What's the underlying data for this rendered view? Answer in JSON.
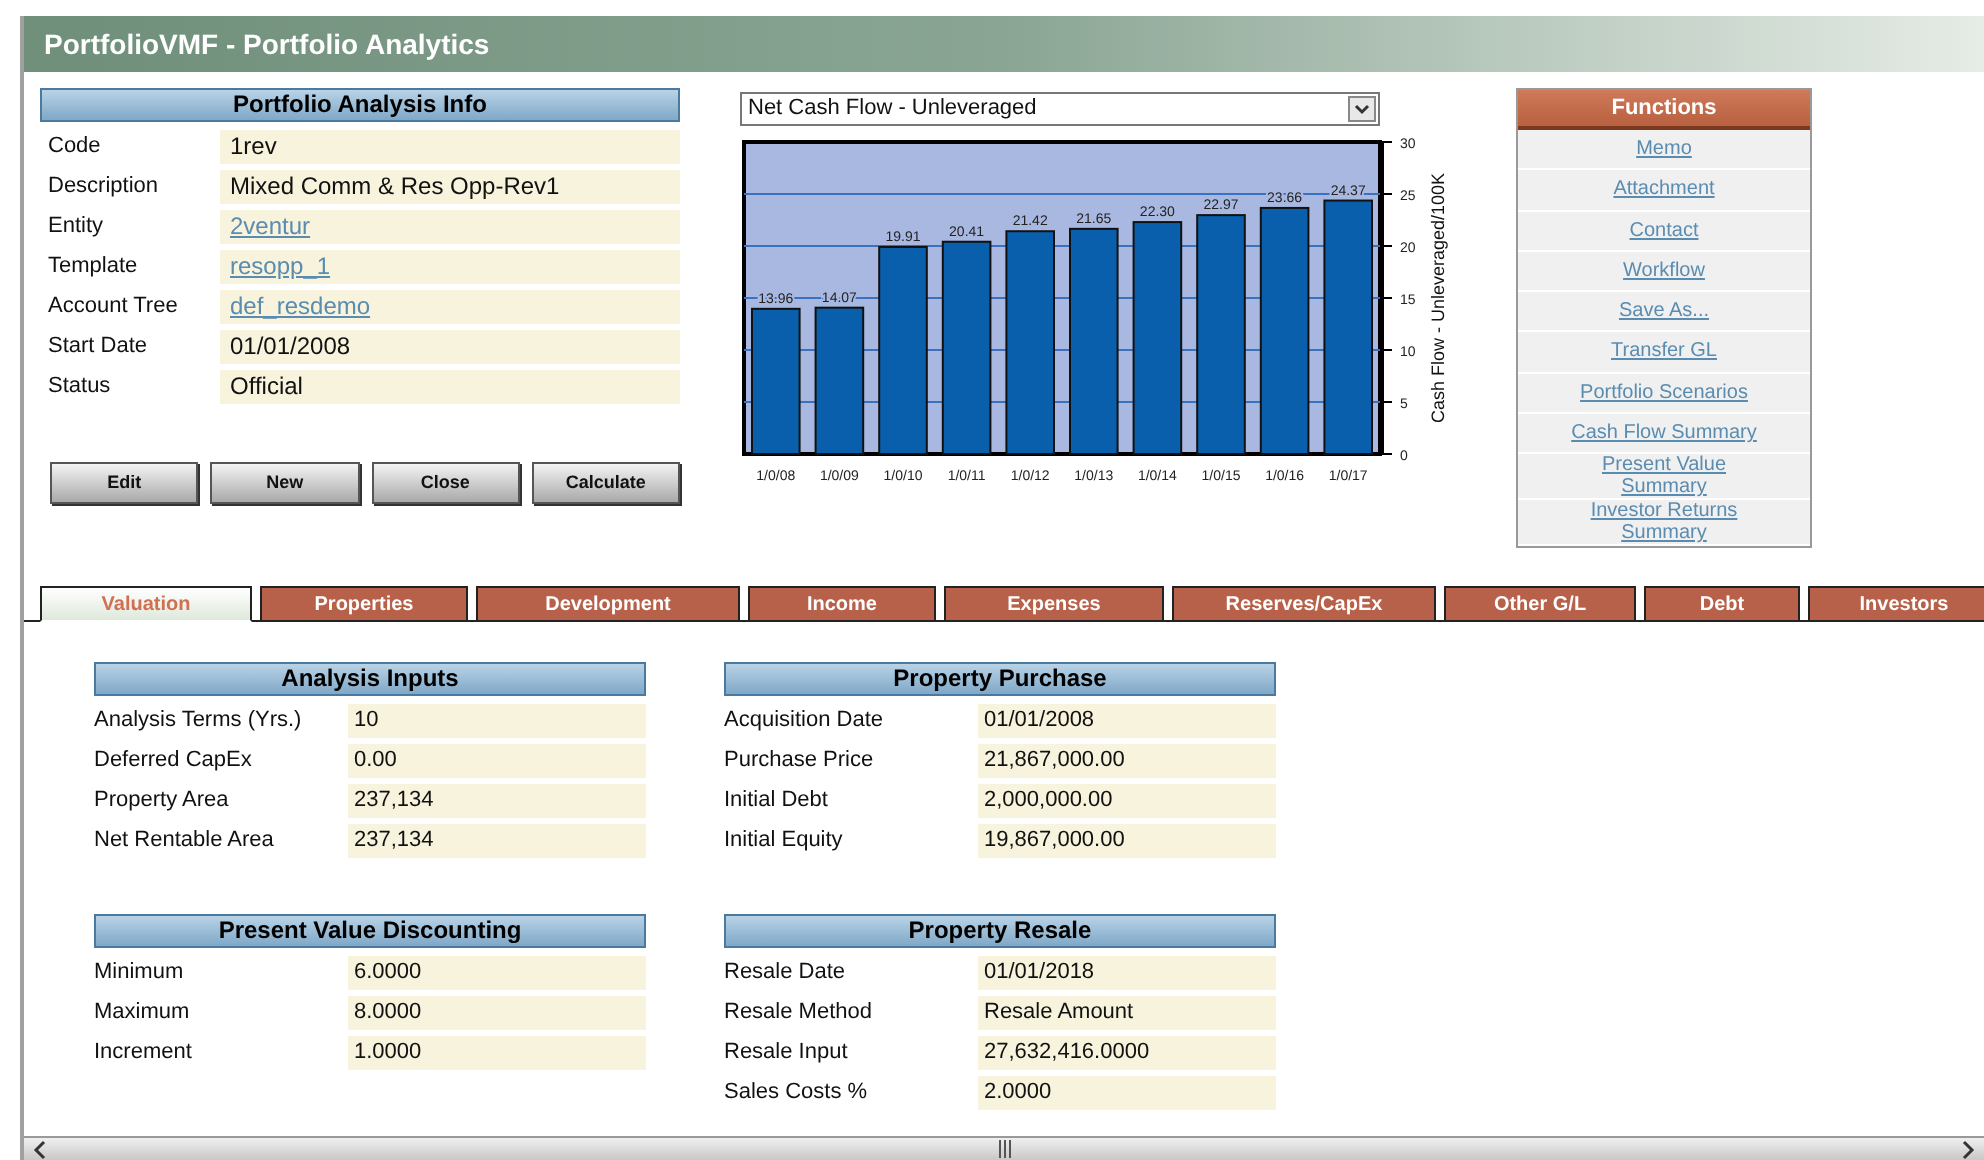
{
  "window": {
    "title": "PortfolioVMF - Portfolio Analytics"
  },
  "info": {
    "title": "Portfolio Analysis Info",
    "rows": [
      {
        "label": "Code",
        "value": "1rev",
        "link": false
      },
      {
        "label": "Description",
        "value": "Mixed Comm & Res Opp-Rev1",
        "link": false
      },
      {
        "label": "Entity",
        "value": "2ventur",
        "link": true
      },
      {
        "label": "Template",
        "value": "resopp_1",
        "link": true
      },
      {
        "label": "Account Tree",
        "value": "def_resdemo",
        "link": true
      },
      {
        "label": "Start Date",
        "value": "01/01/2008",
        "link": false
      },
      {
        "label": "Status",
        "value": "Official",
        "link": false
      }
    ]
  },
  "buttons": [
    "Edit",
    "New",
    "Close",
    "Calculate"
  ],
  "chart": {
    "select": "Net Cash Flow - Unleveraged",
    "chart_data": {
      "type": "bar",
      "ylabel": "Cash Flow - Unleveraged/100K",
      "categories": [
        "1/0/08",
        "1/0/09",
        "1/0/10",
        "1/0/11",
        "1/0/12",
        "1/0/13",
        "1/0/14",
        "1/0/15",
        "1/0/16",
        "1/0/17"
      ],
      "series": [
        {
          "color": "#0a5fac",
          "values": [
            13.96,
            14.07,
            19.91,
            20.41,
            21.42,
            21.65,
            22.3,
            22.97,
            23.66,
            24.37
          ]
        }
      ],
      "ylim": [
        0,
        30
      ],
      "yticks": [
        0,
        5,
        10,
        15,
        20,
        25,
        30
      ],
      "grid": true,
      "value_labels": [
        "13.96",
        "14.07",
        "19.91",
        "20.41",
        "21.42",
        "21.65",
        "22.30",
        "22.97",
        "23.66",
        "24.37"
      ]
    }
  },
  "functions": {
    "title": "Functions",
    "items": [
      "Memo",
      "Attachment",
      "Contact",
      "Workflow",
      "Save As...",
      "Transfer GL",
      "Portfolio Scenarios",
      "Cash Flow Summary",
      "Present Value Summary",
      "Investor Returns Summary"
    ]
  },
  "tabs": [
    {
      "label": "Valuation",
      "selected": true
    },
    {
      "label": "Properties",
      "selected": false
    },
    {
      "label": "Development",
      "selected": false
    },
    {
      "label": "Income",
      "selected": false
    },
    {
      "label": "Expenses",
      "selected": false
    },
    {
      "label": "Reserves/CapEx",
      "selected": false
    },
    {
      "label": "Other G/L",
      "selected": false
    },
    {
      "label": "Debt",
      "selected": false
    },
    {
      "label": "Investors",
      "selected": false
    }
  ],
  "sections": [
    {
      "title": "Analysis Inputs",
      "rows": [
        {
          "label": "Analysis Terms (Yrs.)",
          "value": "10"
        },
        {
          "label": "Deferred CapEx",
          "value": "0.00"
        },
        {
          "label": "Property Area",
          "value": "237,134"
        },
        {
          "label": "Net Rentable Area",
          "value": "237,134"
        }
      ]
    },
    {
      "title": "Property Purchase",
      "rows": [
        {
          "label": "Acquisition Date",
          "value": "01/01/2008"
        },
        {
          "label": "Purchase Price",
          "value": "21,867,000.00"
        },
        {
          "label": "Initial Debt",
          "value": "2,000,000.00"
        },
        {
          "label": "Initial Equity",
          "value": "19,867,000.00"
        }
      ]
    },
    {
      "title": "Present Value Discounting",
      "rows": [
        {
          "label": "Minimum",
          "value": "6.0000"
        },
        {
          "label": "Maximum",
          "value": "8.0000"
        },
        {
          "label": "Increment",
          "value": "1.0000"
        }
      ]
    },
    {
      "title": "Property Resale",
      "rows": [
        {
          "label": "Resale  Date",
          "value": "01/01/2018"
        },
        {
          "label": "Resale Method",
          "value": "Resale Amount"
        },
        {
          "label": "Resale Input",
          "value": "27,632,416.0000"
        },
        {
          "label": "Sales Costs %",
          "value": "2.0000"
        }
      ]
    }
  ]
}
